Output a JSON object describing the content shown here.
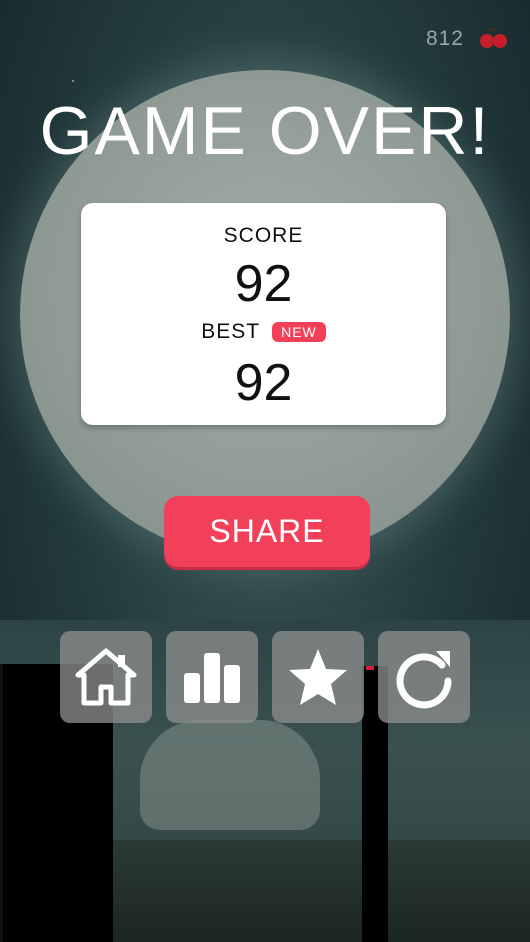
{
  "hud": {
    "currency_count": "812",
    "currency_icon": "cherry-icon"
  },
  "title": "GAME OVER!",
  "score_card": {
    "score_label": "SCORE",
    "score_value": "92",
    "best_label": "BEST",
    "new_badge": "NEW",
    "best_value": "92"
  },
  "share_button": {
    "label": "SHARE"
  },
  "action_buttons": [
    {
      "icon": "home-icon"
    },
    {
      "icon": "leaderboard-icon"
    },
    {
      "icon": "star-icon"
    },
    {
      "icon": "restart-icon"
    }
  ],
  "colors": {
    "accent": "#f2405a",
    "card": "#ffffff",
    "button_bg": "#8c8c8c"
  }
}
